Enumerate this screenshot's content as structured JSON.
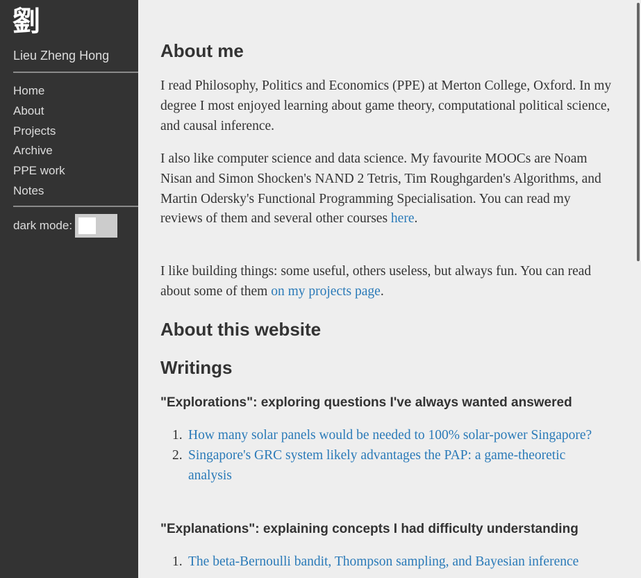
{
  "sidebar": {
    "logo": "劉",
    "site_name": "Lieu Zheng Hong",
    "nav": [
      "Home",
      "About",
      "Projects",
      "Archive",
      "PPE work",
      "Notes"
    ],
    "dark_mode_label": "dark mode:"
  },
  "main": {
    "about_title": "About me",
    "p1": "I read Philosophy, Politics and Economics (PPE) at Merton College, Oxford. In my degree I most enjoyed learning about game theory, computational political science, and causal inference.",
    "p2_text": "I also like computer science and data science. My favourite MOOCs are Noam Nisan and Simon Shocken's NAND 2 Tetris, Tim Roughgarden's Algorithms, and Martin Odersky's Functional Programming Specialisation. You can read my reviews of them and several other courses ",
    "p2_link": "here",
    "p2_end": ".",
    "p3_text": "I like building things: some useful, others useless, but always fun. You can read about some of them ",
    "p3_link": "on my projects page",
    "p3_end": ".",
    "website_title": "About this website",
    "writings_title": "Writings",
    "explorations_title": "\"Explorations\": exploring questions I've always wanted answered",
    "explorations": [
      {
        "num": "1.",
        "title": "How many solar panels would be needed to 100% solar-power Singapore?"
      },
      {
        "num": "2.",
        "title": "Singapore's GRC system likely advantages the PAP: a game-theoretic analysis"
      }
    ],
    "explanations_title": "\"Explanations\": explaining concepts I had difficulty understanding",
    "explanations": [
      {
        "num": "1.",
        "title": "The beta-Bernoulli bandit, Thompson sampling, and Bayesian inference"
      }
    ]
  },
  "colors": {
    "sidebar_bg": "#333333",
    "page_bg": "#eeeeee",
    "link": "#2a7ab8"
  }
}
